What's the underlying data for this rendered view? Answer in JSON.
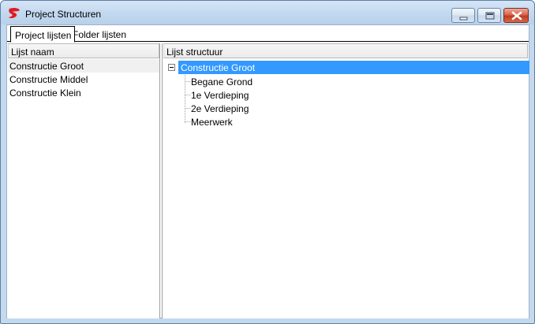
{
  "window": {
    "title": "Project Structuren"
  },
  "tabs": [
    {
      "label": "Project lijsten",
      "active": true
    },
    {
      "label": "Folder lijsten",
      "active": false
    }
  ],
  "left_panel": {
    "header": "Lijst naam",
    "items": [
      {
        "label": "Constructie Groot",
        "selected": true
      },
      {
        "label": "Constructie Middel",
        "selected": false
      },
      {
        "label": "Constructie Klein",
        "selected": false
      }
    ]
  },
  "right_panel": {
    "header": "Lijst structuur",
    "tree": {
      "root": "Constructie Groot",
      "expanded": true,
      "children": [
        "Begane Grond",
        "1e Verdieping",
        "2e Verdieping",
        "Meerwerk"
      ]
    }
  },
  "colors": {
    "selection": "#3399ff",
    "close_button": "#c23a1d",
    "frame": "#c4d9ee"
  }
}
